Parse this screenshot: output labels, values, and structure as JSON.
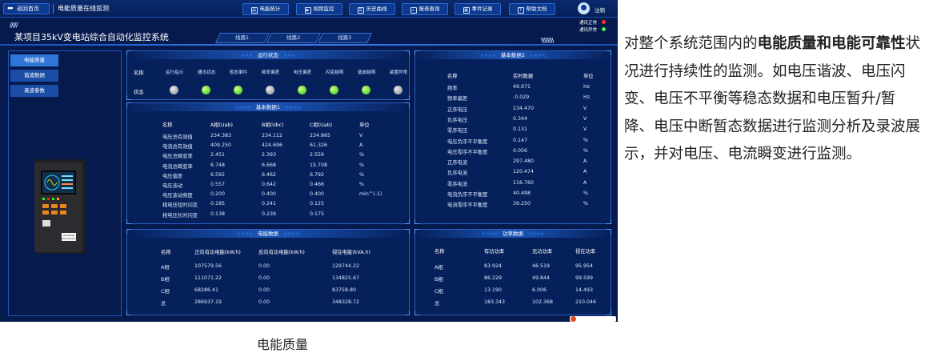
{
  "topbar": {
    "back_label": "返回首页",
    "page_title": "电能质量在线监测",
    "buttons": [
      "电能统计",
      "视频监控",
      "历史曲线",
      "报表查询",
      "事件记录",
      "帮助文档"
    ],
    "logout": "注销"
  },
  "header": {
    "system_title": "某项目35kV变电站综合自动化监控系统",
    "line_tabs": [
      "线路1",
      "线路2",
      "线路3"
    ],
    "status": [
      {
        "label": "通讯正常",
        "color": "#ff2b2b"
      },
      {
        "label": "通讯异常",
        "color": "#3cff4a"
      }
    ]
  },
  "sidebar": {
    "items": [
      "电能质量",
      "谐波数据",
      "录波参数"
    ]
  },
  "run_status": {
    "title": "运行状态",
    "name_label": "名称",
    "state_label": "状态",
    "columns": [
      "运行指示",
      "通讯状态",
      "暂态事件",
      "频率偏差",
      "电压偏差",
      "闪变越限",
      "谐波越限",
      "装置异常"
    ],
    "states": [
      false,
      true,
      true,
      false,
      true,
      true,
      true,
      false
    ]
  },
  "basic1": {
    "title": "基本数据1",
    "headers": [
      "名称",
      "A相(Uab)",
      "B相(Ubc)",
      "C相(Uab)",
      "单位"
    ],
    "rows": [
      [
        "电压总有效值",
        "234.383",
        "234.112",
        "234.865",
        "V"
      ],
      [
        "电流总有效值",
        "409.250",
        "424.696",
        "61.326",
        "A"
      ],
      [
        "电压总畸变率",
        "2.451",
        "2.393",
        "2.559",
        "%"
      ],
      [
        "电流总畸变率",
        "6.748",
        "6.668",
        "15.708",
        "%"
      ],
      [
        "电压偏差",
        "6.592",
        "6.462",
        "6.792",
        "%"
      ],
      [
        "电压波动",
        "0.557",
        "0.642",
        "0.466",
        "%"
      ],
      [
        "电压波动频度",
        "0.200",
        "0.400",
        "0.400",
        "min^(-1)"
      ],
      [
        "相电压短时闪变",
        "0.185",
        "0.241",
        "0.125",
        ""
      ],
      [
        "相电压长时闪变",
        "0.138",
        "0.239",
        "0.175",
        ""
      ]
    ]
  },
  "basic2": {
    "title": "基本数据2",
    "headers": [
      "名称",
      "实时数据",
      "单位"
    ],
    "rows": [
      [
        "频率",
        "49.971",
        "Hz"
      ],
      [
        "频率偏差",
        "-0.029",
        "Hz"
      ],
      [
        "正序电压",
        "234.470",
        "V"
      ],
      [
        "负序电压",
        "0.344",
        "V"
      ],
      [
        "零序电压",
        "0.131",
        "V"
      ],
      [
        "电压负序不平衡度",
        "0.147",
        "%"
      ],
      [
        "电压零序不平衡度",
        "0.056",
        "%"
      ],
      [
        "正序电流",
        "297.480",
        "A"
      ],
      [
        "负序电流",
        "120.474",
        "A"
      ],
      [
        "零序电流",
        "116.760",
        "A"
      ],
      [
        "电流负序不平衡度",
        "40.498",
        "%"
      ],
      [
        "电流零序不平衡度",
        "39.250",
        "%"
      ]
    ]
  },
  "energy": {
    "title": "电能数据",
    "headers": [
      "名称",
      "正向有功电能(kW.h)",
      "反向有功电能(kW.h)",
      "视在电能(kVA.h)"
    ],
    "rows": [
      [
        "A相",
        "107579.56",
        "0.00",
        "129744.22"
      ],
      [
        "B相",
        "111071.22",
        "0.00",
        "134825.67"
      ],
      [
        "C相",
        "68286.41",
        "0.00",
        "83758.80"
      ],
      [
        "总",
        "286937.19",
        "0.00",
        "348328.72"
      ]
    ]
  },
  "power": {
    "title": "功率数据",
    "headers": [
      "名称",
      "有功功率",
      "无功功率",
      "视在功率"
    ],
    "rows": [
      [
        "A相",
        "83.924",
        "46.519",
        "95.954"
      ],
      [
        "B相",
        "86.229",
        "49.844",
        "99.599"
      ],
      [
        "C相",
        "13.190",
        "6.006",
        "14.493"
      ],
      [
        "总",
        "183.343",
        "102.368",
        "210.046"
      ]
    ]
  },
  "device": {
    "label_line1": "APView500",
    "label_line2": "Power Monitor"
  },
  "caption": "电能质量",
  "description": {
    "p1": "对整个系统范围内的",
    "bold": "电能质量和电能可靠性",
    "p2": "状况进行持续性的监测。如电压谐波、电压闪变、电压不平衡等稳态数据和电压暂升/暂降、电压中断暂态数据进行监测分析及录波展示，并对电压、电流瞬变进行监测。"
  }
}
